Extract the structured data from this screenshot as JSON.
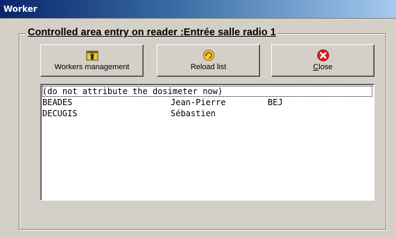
{
  "window": {
    "title": "Worker"
  },
  "group": {
    "title": "Controlled area entry on reader  :Entrée salle radio 1"
  },
  "buttons": {
    "workers": {
      "label": "Workers management",
      "icon": "workers-management-icon"
    },
    "reload": {
      "label": "Reload list",
      "icon": "reload-icon"
    },
    "close": {
      "label": "Close",
      "icon": "close-icon"
    }
  },
  "list": {
    "rows": [
      {
        "text": "(do not attribute the dosimeter now)",
        "selected": true
      },
      {
        "last": "BEADES",
        "first": "Jean-Pierre",
        "code": "BEJ"
      },
      {
        "last": "DECUGIS",
        "first": "Sébastien",
        "code": ""
      }
    ]
  },
  "colors": {
    "titlebar_start": "#0a246a",
    "titlebar_end": "#a6caf0",
    "face": "#d4d0c8",
    "close_red": "#d8221c"
  }
}
